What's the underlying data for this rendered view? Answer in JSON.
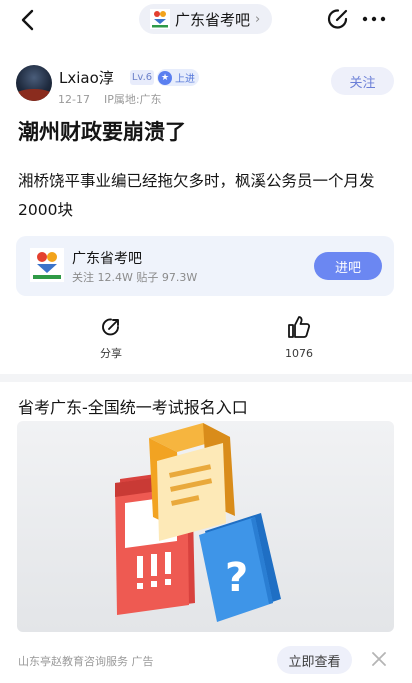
{
  "header": {
    "forum_name": "广东省考吧",
    "back_icon": "back-arrow-icon",
    "edit_icon": "edit-icon",
    "more_icon": "more-dots-icon"
  },
  "author": {
    "name": "Lxiao淳",
    "level": "Lv.6",
    "medal_text": "上进",
    "date": "12-17",
    "ip_location": "IP属地:广东",
    "follow_label": "关注"
  },
  "post": {
    "title": "潮州财政要崩溃了",
    "body": "湘桥饶平事业编已经拖欠多时，枫溪公务员一个月发2000块"
  },
  "forum_card": {
    "name": "广东省考吧",
    "stats": "关注 12.4W  贴子 97.3W",
    "enter_label": "进吧"
  },
  "actions": {
    "share_label": "分享",
    "like_count": "1076"
  },
  "ad": {
    "title": "省考广东-全国统一考试报名入口",
    "source": "山东亭赵教育咨询服务  广告",
    "cta_label": "立即查看"
  },
  "colors": {
    "accent": "#6b87f2",
    "pill_bg": "#eef0fa",
    "card_bg": "#eff3fb"
  }
}
